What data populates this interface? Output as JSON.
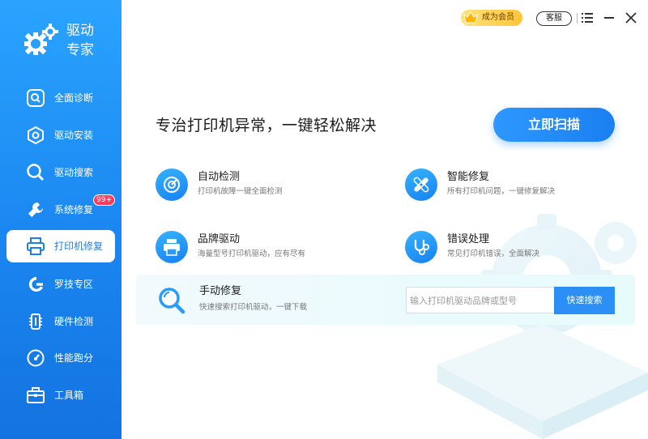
{
  "app": {
    "name_line1": "驱动",
    "name_line2": "专家"
  },
  "sidebar": {
    "items": [
      {
        "label": "全面诊断",
        "icon": "diagnose-icon"
      },
      {
        "label": "驱动安装",
        "icon": "install-icon"
      },
      {
        "label": "驱动搜索",
        "icon": "search-icon"
      },
      {
        "label": "系统修复",
        "icon": "wrench-icon",
        "badge": "99+"
      },
      {
        "label": "打印机修复",
        "icon": "printer-icon",
        "active": true
      },
      {
        "label": "罗技专区",
        "icon": "logitech-icon"
      },
      {
        "label": "硬件检测",
        "icon": "hardware-icon"
      },
      {
        "label": "性能跑分",
        "icon": "speedometer-icon"
      },
      {
        "label": "工具箱",
        "icon": "toolbox-icon"
      }
    ]
  },
  "titlebar": {
    "vip_label": "成为会员",
    "service_label": "客服"
  },
  "main": {
    "headline": "专治打印机异常，一键轻松解决",
    "scan_button": "立即扫描",
    "features": [
      {
        "title": "自动检测",
        "desc": "打印机故障一键全面检测",
        "icon": "auto-detect-icon"
      },
      {
        "title": "智能修复",
        "desc": "所有打印机问题，一键修复解决",
        "icon": "smart-repair-icon"
      },
      {
        "title": "品牌驱动",
        "desc": "海量型号打印机驱动，应有尽有",
        "icon": "printer-driver-icon"
      },
      {
        "title": "错误处理",
        "desc": "常见打印机错误，全面解决",
        "icon": "error-handling-icon"
      }
    ],
    "manual": {
      "title": "手动修复",
      "desc": "快速搜索打印机驱动，一键下载",
      "search_placeholder": "输入打印机驱动品牌或型号",
      "search_button": "快速搜索"
    }
  },
  "colors": {
    "sidebar": "#1a86f0",
    "accent": "#2b8ff5",
    "vip": "#ffc53a",
    "badge": "#ff3b5c"
  }
}
